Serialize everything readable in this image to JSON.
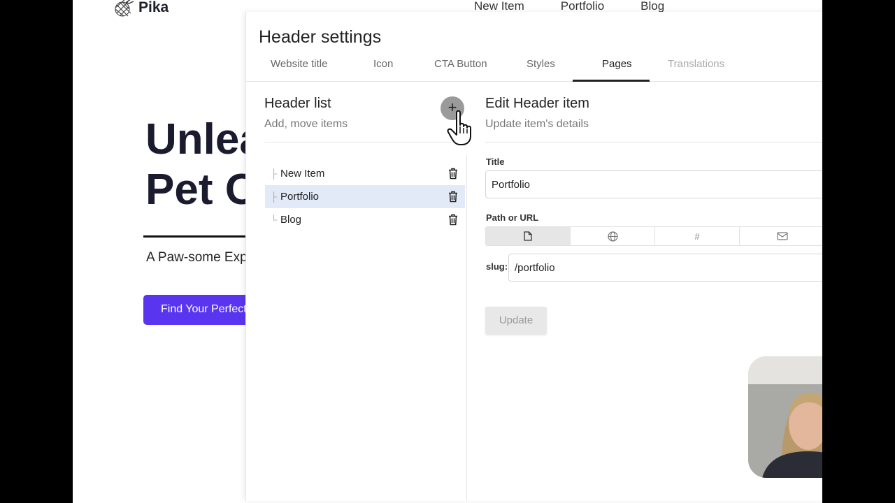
{
  "site": {
    "logo_text": "Pika",
    "nav": [
      "New Item",
      "Portfolio",
      "Blog"
    ],
    "hero_line1": "Unlea",
    "hero_line2": "Pet O",
    "hero_sub": "A Paw-some Exp",
    "cta_label": "Find Your Perfect",
    "accent": "#5a35f0"
  },
  "panel": {
    "title": "Header settings",
    "tabs": [
      {
        "label": "Website title"
      },
      {
        "label": "Icon"
      },
      {
        "label": "CTA Button"
      },
      {
        "label": "Styles"
      },
      {
        "label": "Pages",
        "active": true
      },
      {
        "label": "Translations"
      }
    ],
    "list": {
      "title": "Header list",
      "subtitle": "Add, move items",
      "add_icon": "plus-icon",
      "items": [
        {
          "label": "New Item",
          "branch": "├"
        },
        {
          "label": "Portfolio",
          "branch": "├",
          "selected": true
        },
        {
          "label": "Blog",
          "branch": "└"
        }
      ]
    },
    "edit": {
      "title": "Edit Header item",
      "subtitle": "Update item's details",
      "title_label": "Title",
      "title_value": "Portfolio",
      "path_label": "Path or URL",
      "path_types": [
        "page-icon",
        "globe-icon",
        "hash-icon",
        "mail-icon"
      ],
      "slug_label": "slug:",
      "slug_value": "/portfolio",
      "update_label": "Update"
    }
  }
}
